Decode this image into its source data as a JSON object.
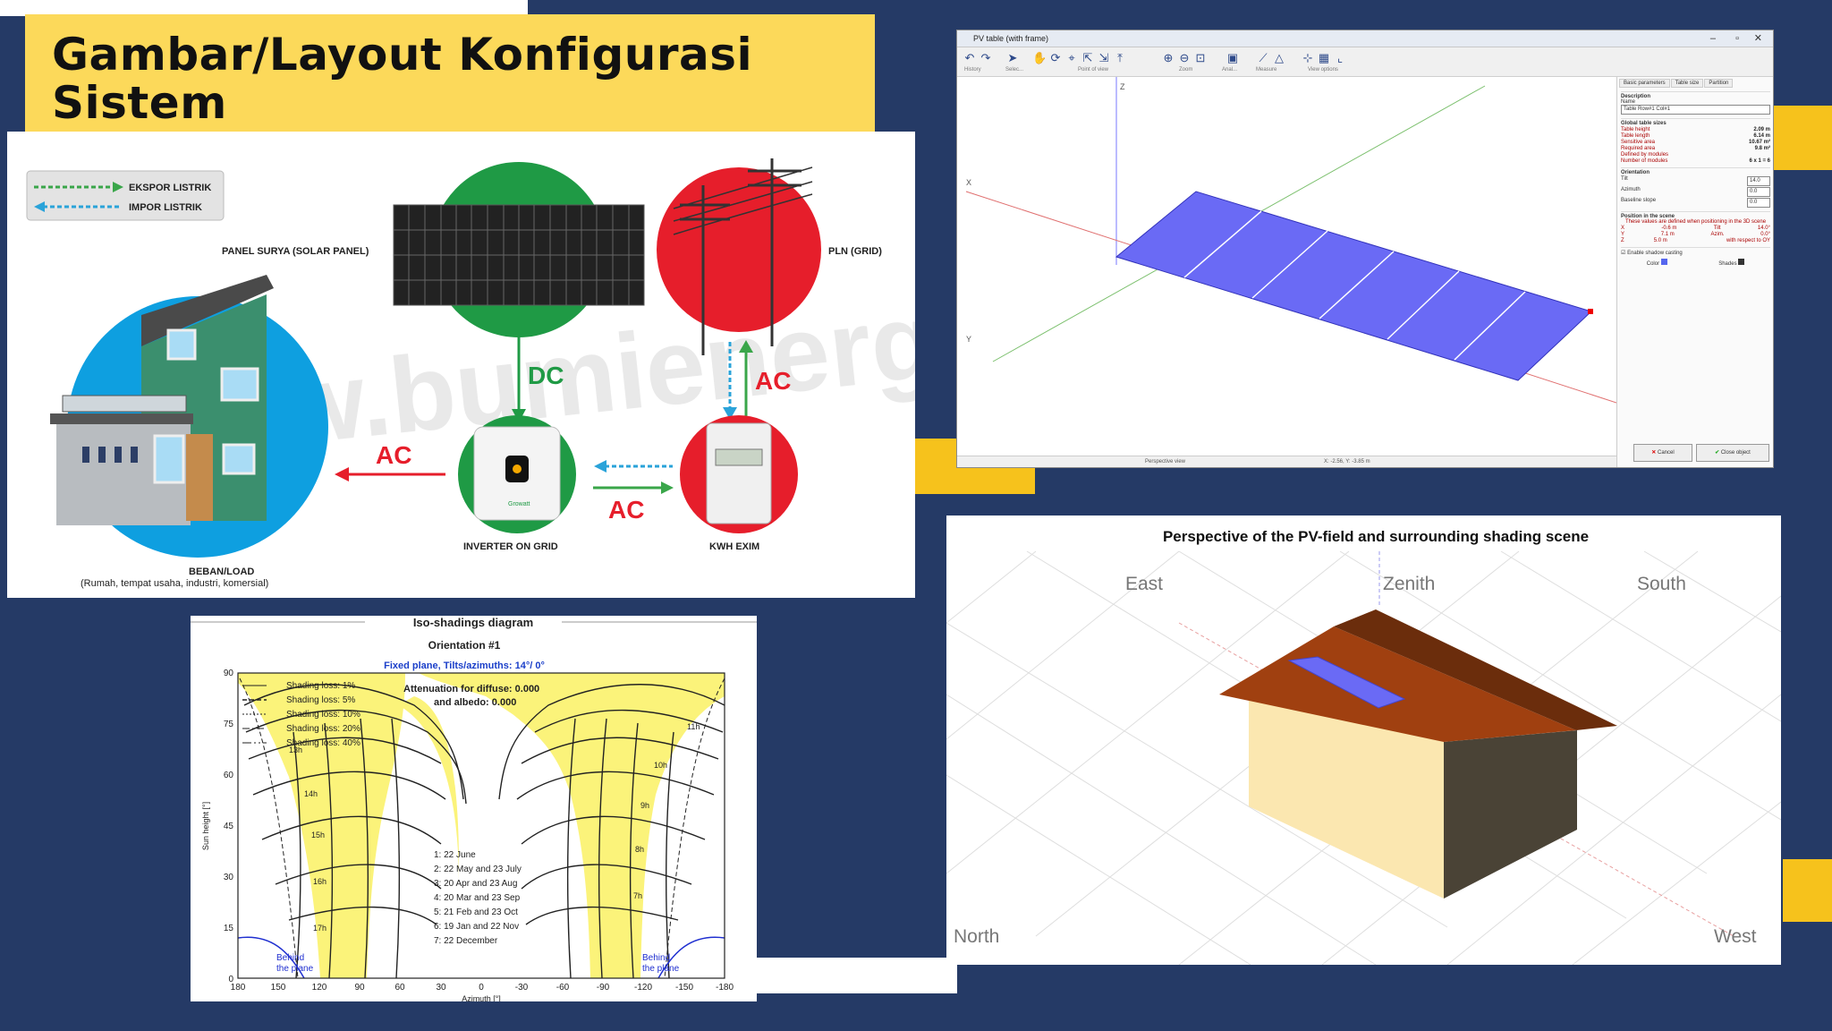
{
  "slide": {
    "title": "Gambar/Layout Konfigurasi Sistem",
    "colors": {
      "background": "#253a66",
      "accent": "#fcd95a",
      "accent_dark": "#f6c21c"
    }
  },
  "system_diagram": {
    "legend": {
      "export": "EKSPOR LISTRIK",
      "import": "IMPOR LISTRIK"
    },
    "solar_panel_label": "PANEL SURYA (SOLAR PANEL)",
    "grid_label": "PLN (GRID)",
    "inverter_label": "INVERTER ON GRID",
    "kwh_label": "KWH EXIM",
    "load_label": "BEBAN/LOAD",
    "load_sublabel": "(Rumah, tempat usaha, industri, komersial)",
    "flow_dc": "DC",
    "flow_ac_grid": "AC",
    "flow_ac_load": "AC",
    "flow_ac_meter": "AC",
    "watermark": "www.bumienergisurya.com",
    "inverter_brand": "Growatt"
  },
  "pv_window": {
    "title": "PV table (with frame)",
    "toolbar_groups": [
      "History",
      "Selec...",
      "Point of view",
      "Zoom",
      "Anal...",
      "Measure",
      "View options"
    ],
    "axis_labels": {
      "z": "Z",
      "x": "X",
      "y": "Y"
    },
    "tabs": [
      "Basic parameters",
      "Table size",
      "Partition"
    ],
    "description_header": "Description",
    "name_label": "Name",
    "name_value": "Table Row#1 Col#1",
    "global_sizes_header": "Global table sizes",
    "sizes": [
      {
        "label": "Table height",
        "value": "2.09 m"
      },
      {
        "label": "Table length",
        "value": "6.14 m"
      },
      {
        "label": "Sensitive area",
        "value": "10.67 m²"
      },
      {
        "label": "Required area",
        "value": "9.8 m²"
      },
      {
        "label": "Defined by modules",
        "value": ""
      },
      {
        "label": "Number of modules",
        "value": "6 x 1 = 6"
      }
    ],
    "orientation_header": "Orientation",
    "orientation": [
      {
        "label": "Tilt",
        "value": "14.0"
      },
      {
        "label": "Azimuth",
        "value": "0.0"
      },
      {
        "label": "Baseline slope",
        "value": "0.0"
      }
    ],
    "position_header": "Position in the scene",
    "position_note": "These values are defined when positioning in the 3D scene",
    "position_rows": [
      {
        "axis": "X",
        "val": "-0.6 m",
        "k": "Tilt",
        "v": "14.0°"
      },
      {
        "axis": "Y",
        "val": "7.1 m",
        "k": "Azim.",
        "v": "0.0°"
      },
      {
        "axis": "Z",
        "val": "5.0 m",
        "k": "",
        "v": "with respect to OY"
      }
    ],
    "shadow_label": "Enable shadow casting",
    "color_label": "Color",
    "shades_label": "Shades",
    "cancel_label": "Cancel",
    "close_label": "Close object",
    "status_view": "Perspective view",
    "status_coords": "X: -2.56, Y: -3.85 m"
  },
  "iso_diagram": {
    "title": "Iso-shadings diagram",
    "subtitle": "Orientation #1",
    "plane_label": "Fixed plane, Tilts/azimuths: 14°/ 0°",
    "attenuation_label": "Attenuation for diffuse: 0.000",
    "albedo_label": "and albedo: 0.000",
    "loss_legend": [
      "Shading loss: 1%",
      "Shading loss: 5%",
      "Shading loss: 10%",
      "Shading loss: 20%",
      "Shading loss: 40%"
    ],
    "dates": [
      "1: 22 June",
      "2: 22 May and 23 July",
      "3: 20 Apr and 23 Aug",
      "4: 20 Mar and 23 Sep",
      "5: 21 Feb and 23 Oct",
      "6: 19 Jan and 22 Nov",
      "7: 22 December"
    ],
    "ylabel": "Sun height [°]",
    "xlabel": "Azimuth [°]",
    "y_ticks": [
      "0",
      "15",
      "30",
      "45",
      "60",
      "75",
      "90"
    ],
    "x_ticks": [
      "180",
      "150",
      "120",
      "90",
      "60",
      "30",
      "0",
      "-30",
      "-60",
      "-90",
      "-120",
      "-150",
      "-180"
    ],
    "hour_labels": [
      "13h",
      "14h",
      "15h",
      "16h",
      "17h",
      "11h",
      "10h",
      "9h",
      "8h",
      "7h"
    ],
    "behind_label": "Behind the plane"
  },
  "shading_scene": {
    "title": "Perspective of the PV-field and surrounding shading scene",
    "east": "East",
    "zenith": "Zenith",
    "south": "South",
    "north": "North",
    "west": "West"
  }
}
